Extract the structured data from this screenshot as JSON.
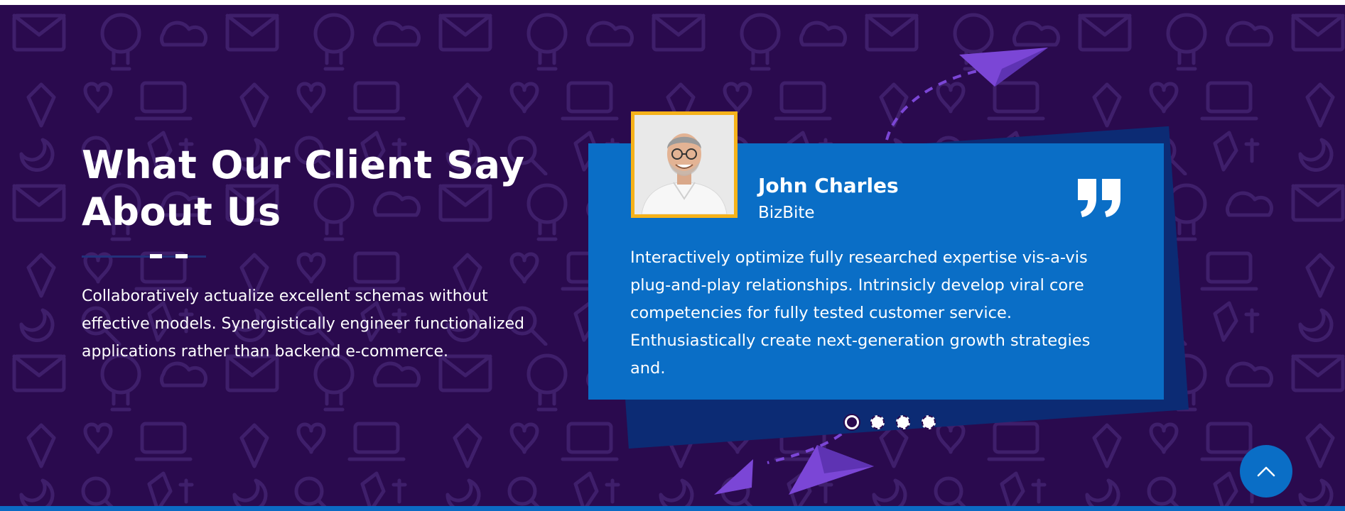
{
  "section": {
    "heading": "What Our Client Say About Us",
    "intro": "Collaboratively actualize excellent schemas without effective models. Synergistically engineer functionalized applications rather than backend e-commerce."
  },
  "testimonial": {
    "name": "John Charles",
    "company": "BizBite",
    "quote": "Interactively optimize fully researched expertise vis-a-vis plug-and-play relationships. Intrinsicly develop viral core competencies for fully tested customer service. Enthusiastically create next-generation growth strategies and.",
    "avatar": "client-portrait",
    "quote_icon": "quote-icon"
  },
  "slider": {
    "count": 4,
    "active_index": 0
  },
  "scroll_top": {
    "icon": "chevron-up-icon"
  },
  "colors": {
    "background": "#2a0a4e",
    "card": "#0a6ec6",
    "card_shadow": "#0c2b74",
    "avatar_border": "#f6b21a",
    "divider": "#23307a",
    "plane": "#7b46d6",
    "text": "#ffffff"
  }
}
